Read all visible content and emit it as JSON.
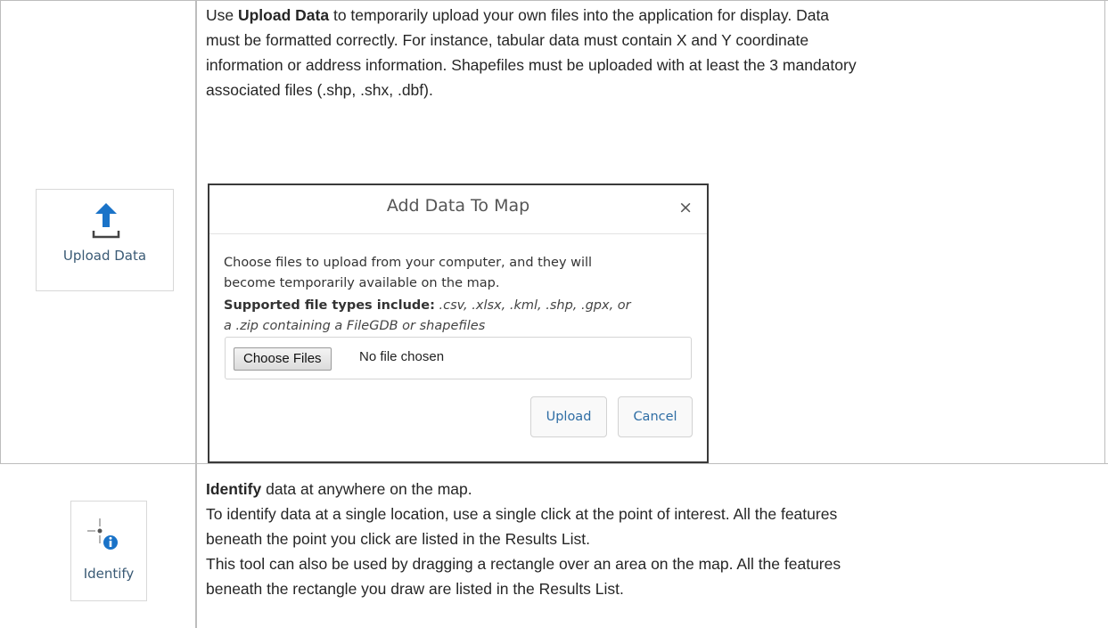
{
  "upload_tool": {
    "button_label": "Upload Data",
    "icon": "upload-icon",
    "intro_bold": "Upload Data",
    "intro_prefix": "Use ",
    "description_lines": [
      " to temporarily upload your own files into the application for display. Data",
      "must be formatted correctly. For instance, tabular data must contain X and Y coordinate",
      "information or address information. Shapefiles must be uploaded with at least the 3 mandatory",
      "associated files (.shp, .shx, .dbf)."
    ]
  },
  "dialog": {
    "title": "Add Data To Map",
    "close_symbol": "×",
    "instructions_lines": [
      "Choose files to upload from your computer, and they will",
      "become temporarily available on the map."
    ],
    "supported_label": "Supported file types include:",
    "supported_types_line1": " .csv, .xlsx, .kml, .shp, .gpx, or",
    "supported_types_line2": "a .zip containing a FileGDB or shapefiles",
    "choose_files_label": "Choose Files",
    "no_file_text": "No file chosen",
    "upload_label": "Upload",
    "cancel_label": "Cancel"
  },
  "identify_tool": {
    "button_label": "Identify",
    "icon": "identify-icon",
    "intro_bold": "Identify",
    "intro_rest": " data at anywhere on the map.",
    "description_lines": [
      "To identify data at a single location, use a single click at the point of interest. All the features",
      "beneath the point you click are listed in the Results List.",
      "This tool can also be used by dragging a rectangle over an area on the map. All the features",
      "beneath the rectangle you draw are listed in the Results List."
    ]
  },
  "colors": {
    "icon_blue": "#1a73c8",
    "label_blue": "#3a5a75",
    "link_blue": "#2e6da4"
  }
}
